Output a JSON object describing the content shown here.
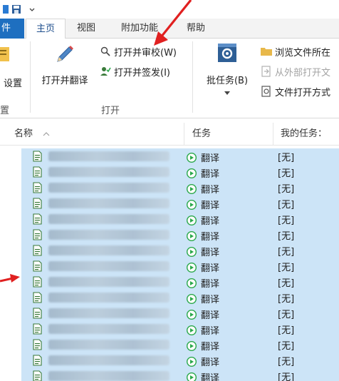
{
  "ribbon_tabs": {
    "file": "件",
    "home": "主页",
    "view": "视图",
    "addins": "附加功能",
    "help": "帮助"
  },
  "ribbon": {
    "group0": {
      "button": "设置",
      "label": "置"
    },
    "open_group": {
      "open_translate": "打开并翻译",
      "open_review": "打开并审校(W)",
      "open_signoff": "打开并签发(I)",
      "label": "打开"
    },
    "batch": {
      "label": "批任务(B)"
    },
    "right_group": {
      "browse": "浏览文件所在",
      "open_external": "从外部打开文",
      "open_mode": "文件打开方式"
    }
  },
  "list": {
    "columns": {
      "name": "名称",
      "task": "任务",
      "my_task": "我的任务："
    },
    "rows": [
      {
        "task": "翻译",
        "my_task": "[无]"
      },
      {
        "task": "翻译",
        "my_task": "[无]"
      },
      {
        "task": "翻译",
        "my_task": "[无]"
      },
      {
        "task": "翻译",
        "my_task": "[无]"
      },
      {
        "task": "翻译",
        "my_task": "[无]"
      },
      {
        "task": "翻译",
        "my_task": "[无]"
      },
      {
        "task": "翻译",
        "my_task": "[无]"
      },
      {
        "task": "翻译",
        "my_task": "[无]"
      },
      {
        "task": "翻译",
        "my_task": "[无]"
      },
      {
        "task": "翻译",
        "my_task": "[无]"
      },
      {
        "task": "翻译",
        "my_task": "[无]"
      },
      {
        "task": "翻译",
        "my_task": "[无]"
      },
      {
        "task": "翻译",
        "my_task": "[无]"
      },
      {
        "task": "翻译",
        "my_task": "[无]"
      },
      {
        "task": "翻译",
        "my_task": "[无]"
      }
    ]
  },
  "colors": {
    "accent": "#1e6fc0",
    "selection": "#cce4f7",
    "play_green": "#2aa84a",
    "annotation_red": "#e02020"
  }
}
